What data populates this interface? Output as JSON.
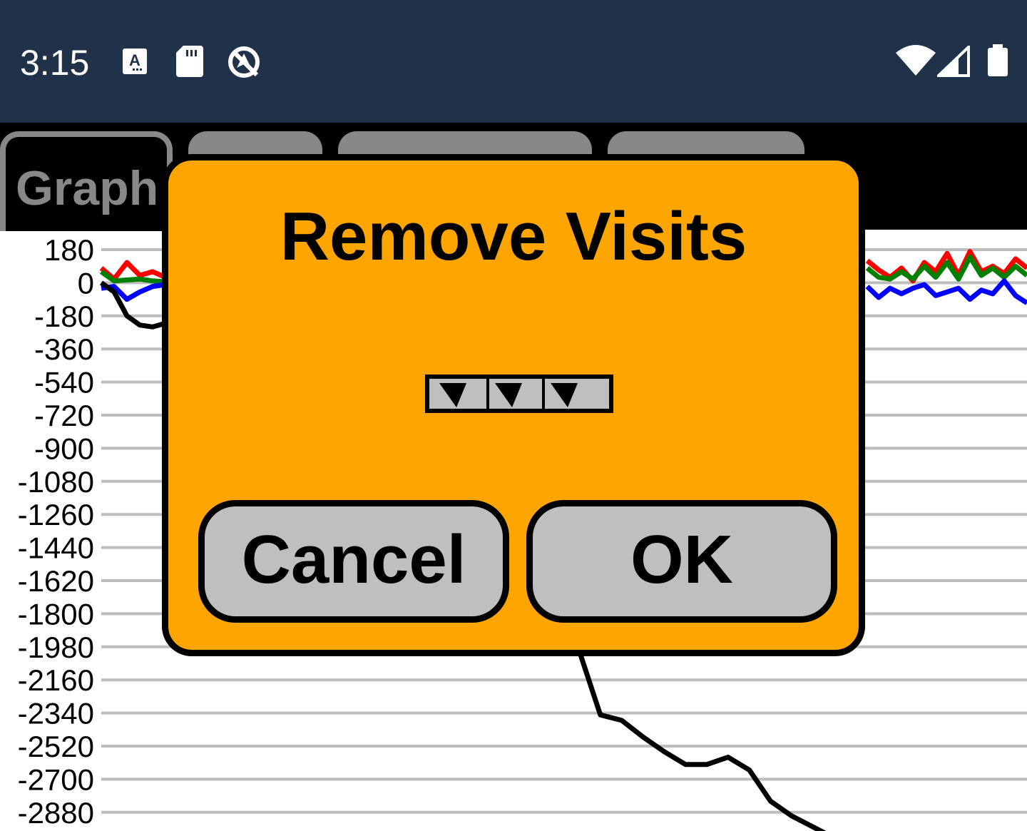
{
  "status_bar": {
    "time": "3:15",
    "background": "#1f324a",
    "left_icons": [
      "keyboard-a-icon",
      "sd-card-icon",
      "no-location-icon"
    ],
    "right_icons": [
      "wifi-icon",
      "cell-signal-icon",
      "battery-icon"
    ]
  },
  "tabs": [
    {
      "label": "Graph",
      "active": true
    },
    {
      "label": "",
      "active": false
    },
    {
      "label": "",
      "active": false
    },
    {
      "label": "",
      "active": false
    }
  ],
  "dialog": {
    "title": "Remove Visits",
    "background": "#ffa500",
    "cancel_label": "Cancel",
    "ok_label": "OK"
  },
  "chart_data": {
    "type": "line",
    "y_ticks": [
      "180",
      "0",
      "-180",
      "-360",
      "-540",
      "-720",
      "-900",
      "-1080",
      "-1260",
      "-1440",
      "-1620",
      "-1800",
      "-1980",
      "-2160",
      "-2340",
      "-2520",
      "-2700",
      "-2880"
    ],
    "ylim": [
      -2880,
      180
    ],
    "grid": true,
    "series_colors": {
      "red": "#ff0000",
      "green": "#008000",
      "blue": "#0000ff",
      "black": "#000000"
    },
    "series_visible": [
      {
        "color": "red",
        "segment": "left",
        "values": [
          80,
          20,
          110,
          40,
          60,
          30
        ]
      },
      {
        "color": "green",
        "segment": "left",
        "values": [
          60,
          10,
          15,
          20,
          10,
          5
        ]
      },
      {
        "color": "blue",
        "segment": "left",
        "values": [
          -30,
          -20,
          -90,
          -50,
          -20,
          -10
        ]
      },
      {
        "color": "black",
        "segment": "left",
        "values": [
          0,
          -50,
          -180,
          -230,
          -240,
          -220
        ]
      },
      {
        "color": "red",
        "segment": "right",
        "values": [
          120,
          70,
          30,
          80,
          10,
          110,
          60,
          160,
          40,
          170,
          60,
          90,
          50,
          130,
          80
        ]
      },
      {
        "color": "green",
        "segment": "right",
        "values": [
          80,
          30,
          20,
          60,
          20,
          90,
          30,
          110,
          20,
          140,
          40,
          80,
          30,
          90,
          40
        ]
      },
      {
        "color": "blue",
        "segment": "right",
        "values": [
          -20,
          -80,
          -30,
          -60,
          -30,
          -10,
          -70,
          -50,
          -30,
          -90,
          -40,
          -60,
          10,
          -70,
          -110
        ]
      },
      {
        "color": "black",
        "segment": "bottom",
        "values": [
          -2000,
          -2350,
          -2380,
          -2470,
          -2550,
          -2620,
          -2620,
          -2580,
          -2650,
          -2820,
          -2900,
          -2960,
          -3020
        ]
      }
    ]
  }
}
